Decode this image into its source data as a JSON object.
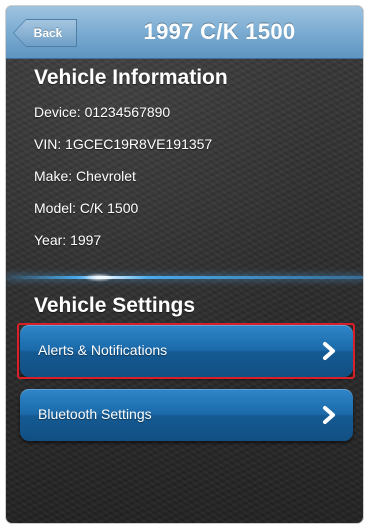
{
  "navbar": {
    "back_label": "Back",
    "title": "1997 C/K 1500"
  },
  "vehicle_info": {
    "title": "Vehicle Information",
    "device": "Device: 01234567890",
    "vin": "VIN: 1GCEC19R8VE191357",
    "make": "Make: Chevrolet",
    "model": "Model: C/K 1500",
    "year": "Year: 1997"
  },
  "vehicle_settings": {
    "title": "Vehicle Settings",
    "items": [
      {
        "label": "Alerts & Notifications",
        "icon": "chevron-right-icon",
        "selected": true
      },
      {
        "label": "Bluetooth Settings",
        "icon": "chevron-right-icon",
        "selected": false
      }
    ]
  },
  "colors": {
    "navbar": "#7eaed3",
    "button": "#1b6aaa",
    "selection_outline": "#d9202a",
    "divider_glow": "#49a9ea"
  }
}
